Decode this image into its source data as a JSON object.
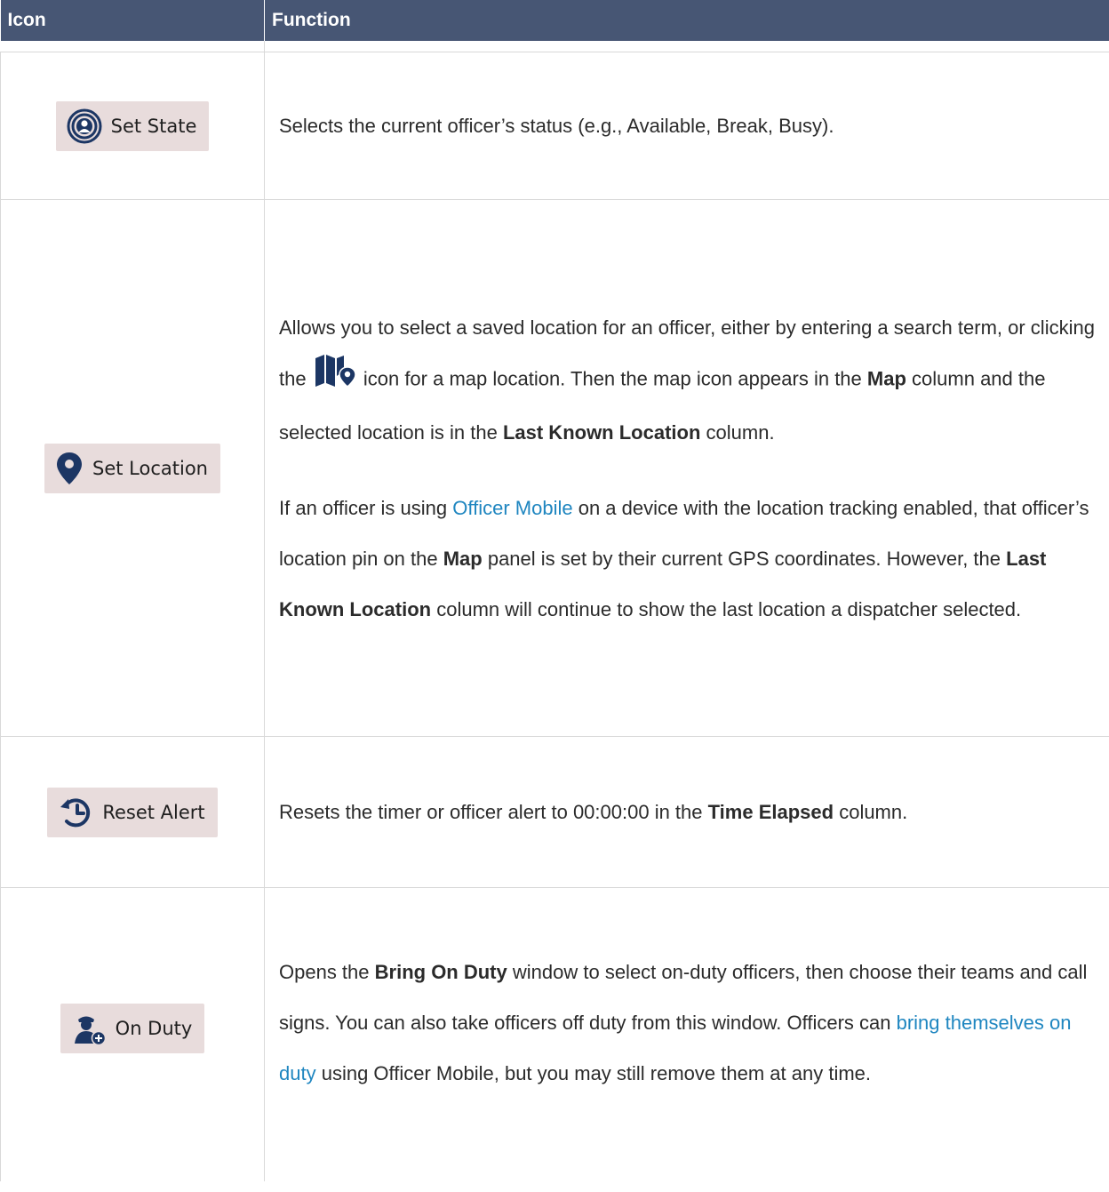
{
  "header": {
    "col_icon": "Icon",
    "col_function": "Function"
  },
  "rows": [
    {
      "button_label": "Set State",
      "icon": "broadcast-person-icon",
      "text": [
        "Selects the current officer’s status (e.g., Available, Break, Busy)."
      ]
    },
    {
      "button_label": "Set Location",
      "icon": "location-pin-icon",
      "p1_a": "Allows you to select a saved location for an officer, either by entering a search term, or clicking the",
      "p1_b": "icon for a map location. Then the map icon appears in the",
      "p1_map": "Map",
      "p1_c": "column and the selected location is in the",
      "p1_lkl": "Last Known Location",
      "p1_d": "column.",
      "p2_a": "If an officer is using",
      "p2_link": "Officer Mobile",
      "p2_b": "on a device with the location tracking enabled, that officer’s location pin on the",
      "p2_map": "Map",
      "p2_c": "panel is set by their current GPS coordinates. However, the",
      "p2_lkl": "Last Known Location",
      "p2_d": "column will continue to show the last location a dispatcher selected.",
      "inline_icon": "map-pin-icon"
    },
    {
      "button_label": "Reset Alert",
      "icon": "reset-clock-icon",
      "a": "Resets the timer or officer alert to 00:00:00 in the",
      "b": "Time Elapsed",
      "c": "column."
    },
    {
      "button_label": "On Duty",
      "icon": "add-officer-icon",
      "a": "Opens the",
      "b": "Bring On Duty",
      "c": "window to select on-duty officers, then choose their teams and call signs. You can also take officers off duty from this window. Officers can",
      "link": "bring themselves on duty",
      "d": "using Officer Mobile, but you may still remove them at any time."
    }
  ],
  "colors": {
    "header_bg": "#475674",
    "icon_blue": "#1c3664",
    "link": "#1f86c0",
    "button_bg": "#e8dcdc"
  }
}
